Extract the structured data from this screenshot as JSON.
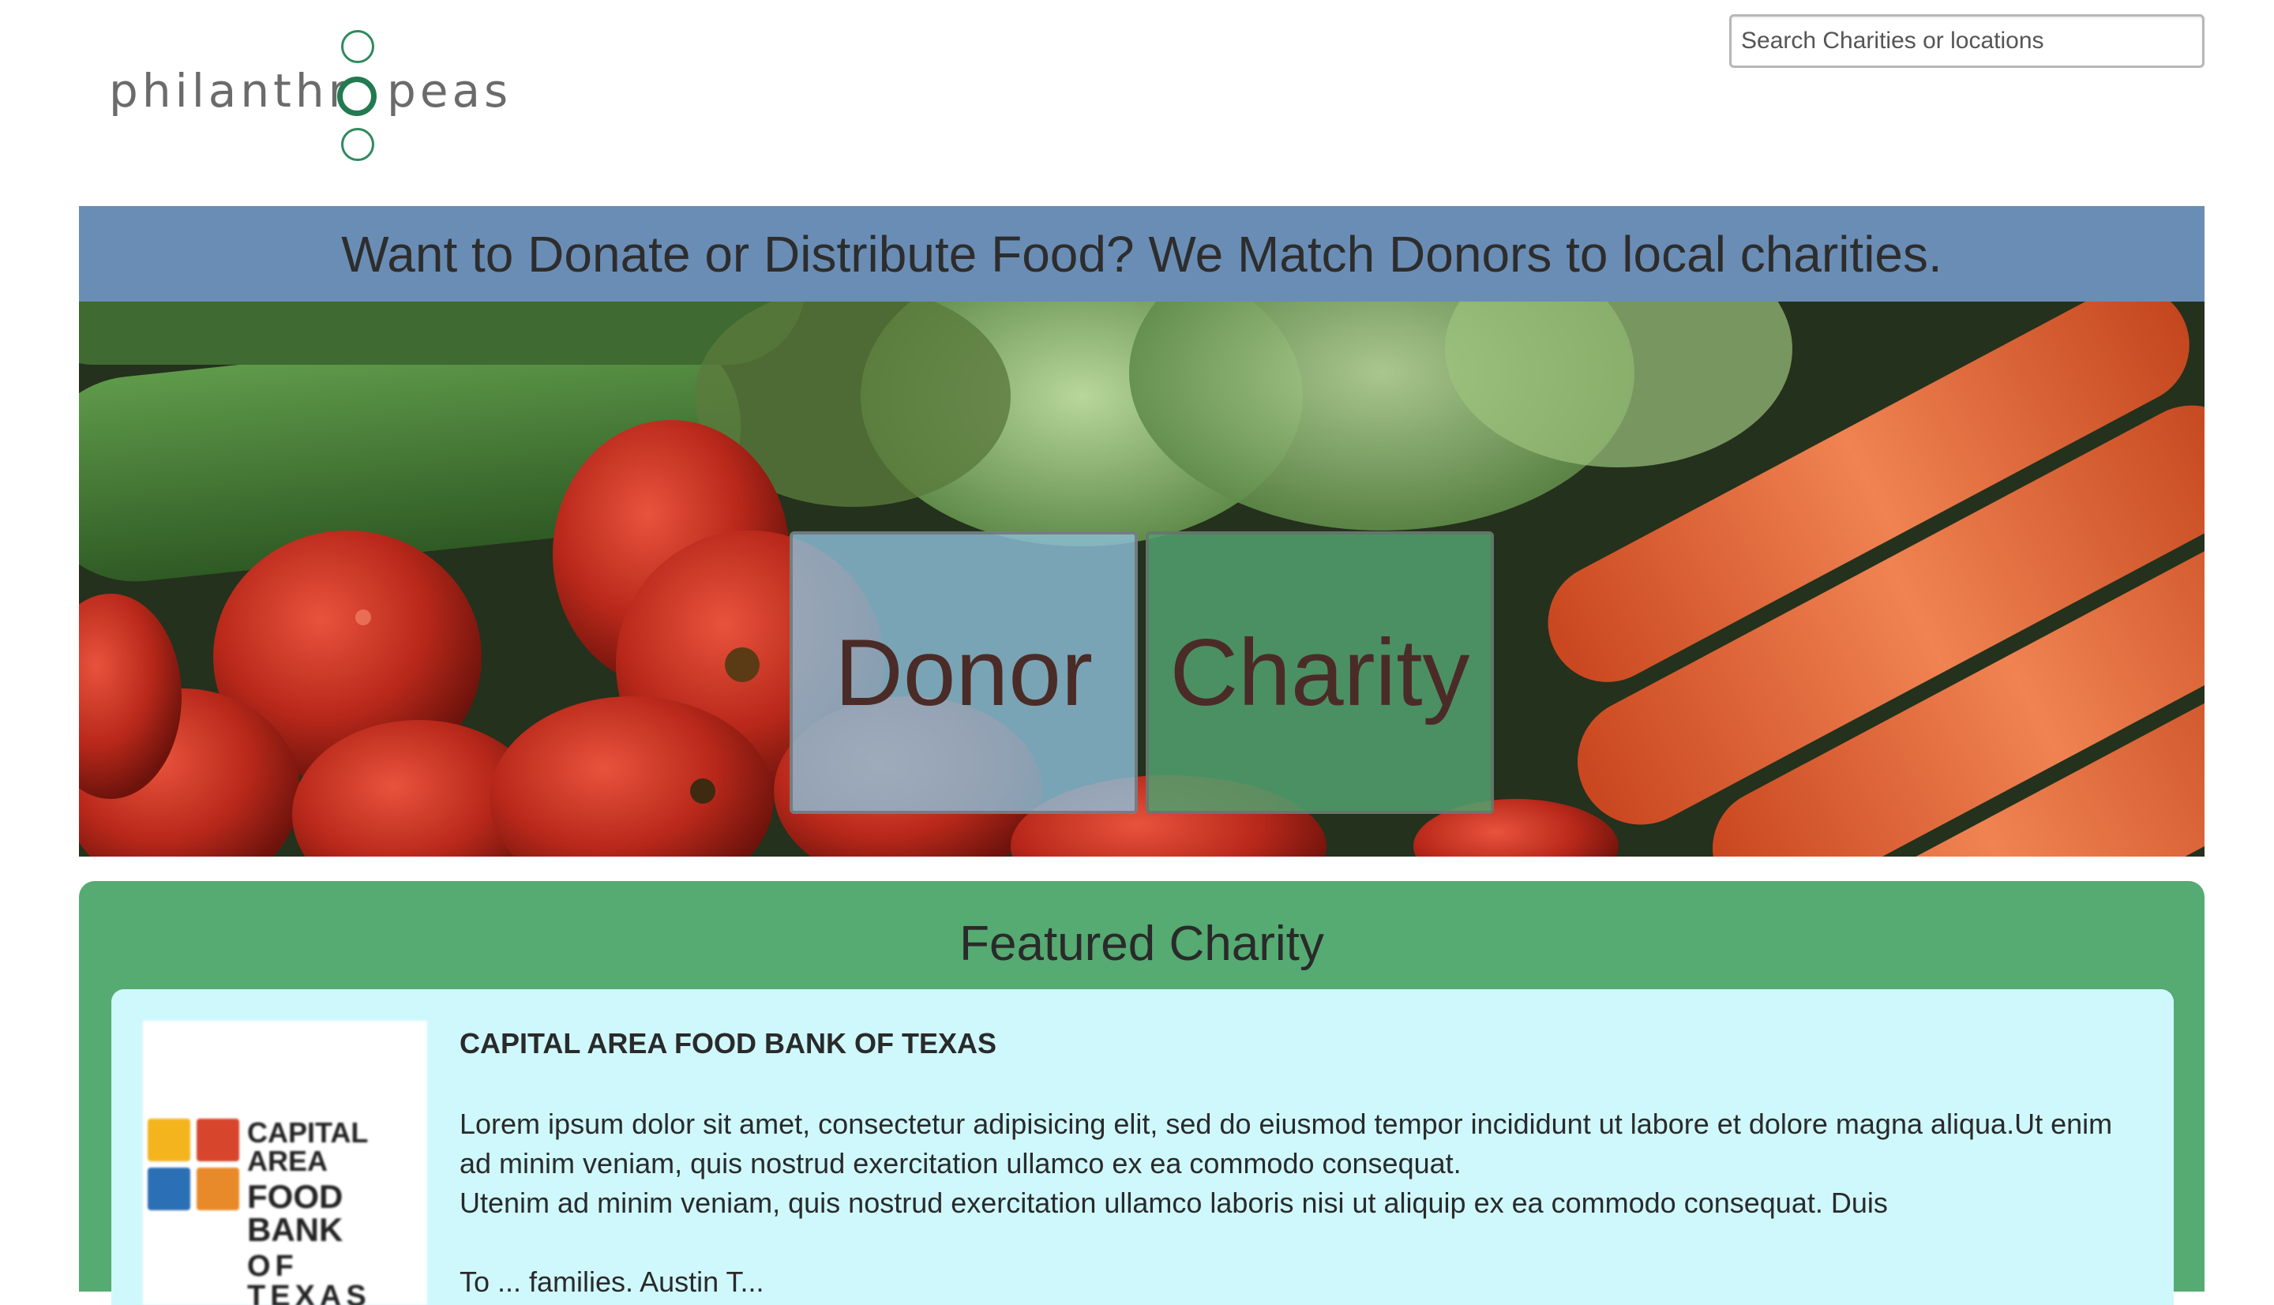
{
  "logo": {
    "left_text": "philanthr",
    "right_text": "peas"
  },
  "search": {
    "placeholder": "Search Charities or locations",
    "value": ""
  },
  "tagline": "Want to Donate or Distribute Food? We Match Donors to local charities.",
  "hero": {
    "donor_label": "Donor",
    "charity_label": "Charity"
  },
  "featured": {
    "title": "Featured Charity",
    "charity": {
      "logo_text": [
        "CAPITAL AREA",
        "FOOD BANK",
        "OF TEXAS"
      ],
      "name": "CAPITAL AREA FOOD BANK OF TEXAS",
      "description_1": "Lorem ipsum dolor sit amet, consectetur adipisicing elit, sed do eiusmod tempor incididunt ut labore et dolore magna aliqua.Ut enim ad minim veniam, quis nostrud exercitation ullamco ex ea commodo consequat.",
      "description_2": "Utenim ad minim veniam, quis nostrud exercitation ullamco laboris nisi ut aliquip ex ea commodo consequat. Duis",
      "description_3": "To ... families. Austin T..."
    }
  },
  "colors": {
    "tagline_bar": "#6a8db5",
    "donor_button": "#8cbed7",
    "charity_button": "#52a06e",
    "featured_section": "#55ab72",
    "charity_card": "#cff8fc",
    "logo_green": "#2e8b5e"
  }
}
